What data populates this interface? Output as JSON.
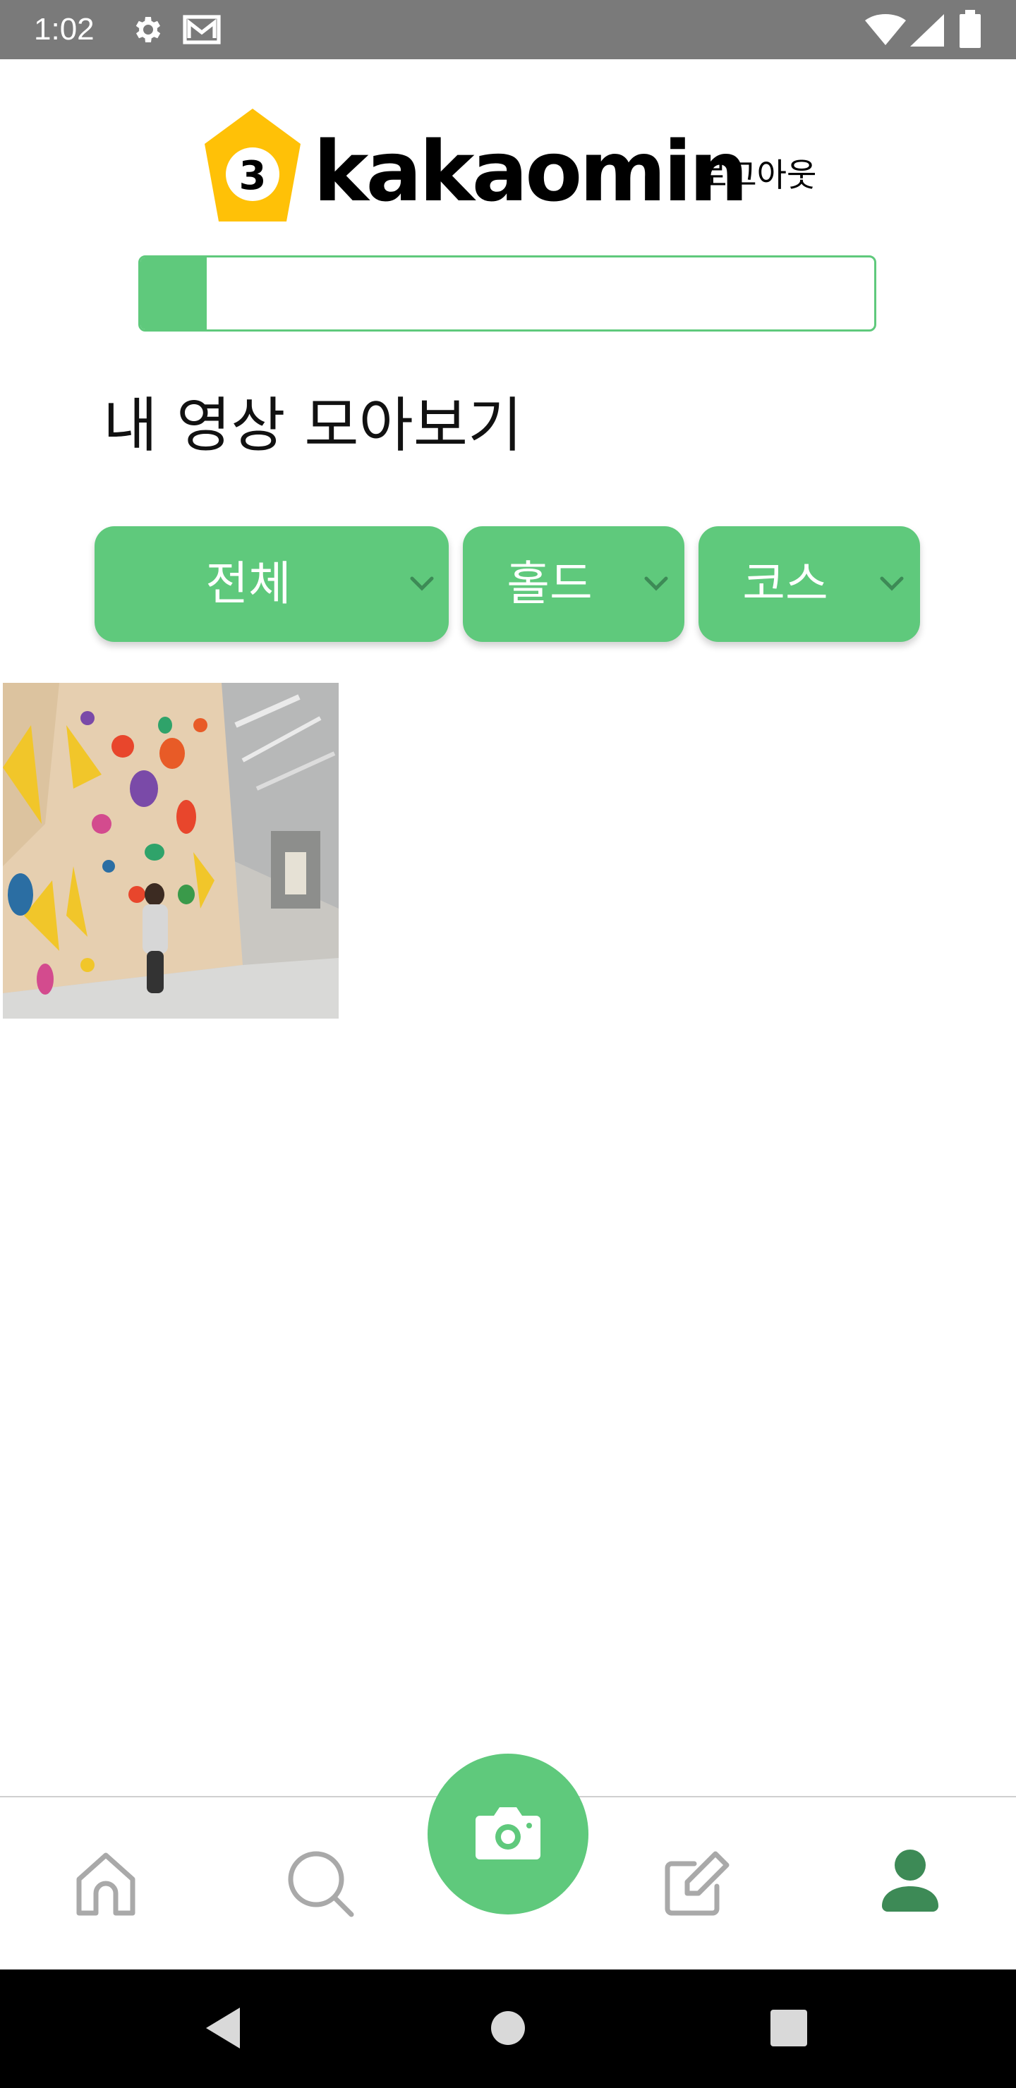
{
  "status_bar": {
    "time": "1:02",
    "icons": [
      "gear-icon",
      "mail-icon",
      "wifi-icon",
      "signal-icon",
      "battery-icon"
    ]
  },
  "header": {
    "logo_badge_text": "3",
    "logo_text": "kakaomin",
    "logout_label": "로그아웃",
    "progress_fraction": 0.09
  },
  "page_title": "내 영상 모아보기",
  "filters": [
    {
      "label": "전체",
      "icon": "chevron-down-icon"
    },
    {
      "label": "홀드",
      "icon": "chevron-down-icon"
    },
    {
      "label": "코스",
      "icon": "chevron-down-icon"
    }
  ],
  "videos": [
    {
      "thumbnail": "climbing-wall-photo"
    }
  ],
  "bottom_nav": {
    "items": [
      "home-icon",
      "search-icon",
      "camera-icon",
      "edit-icon",
      "profile-icon"
    ],
    "active": "profile-icon"
  },
  "android_nav": [
    "back-icon",
    "home-circle-icon",
    "recents-icon"
  ],
  "colors": {
    "accent": "#5fc97c",
    "nav_inactive": "#a9a9a9",
    "nav_active": "#3d8a56",
    "logo_yellow": "#ffc107",
    "status_bar": "#7a7a7a"
  }
}
